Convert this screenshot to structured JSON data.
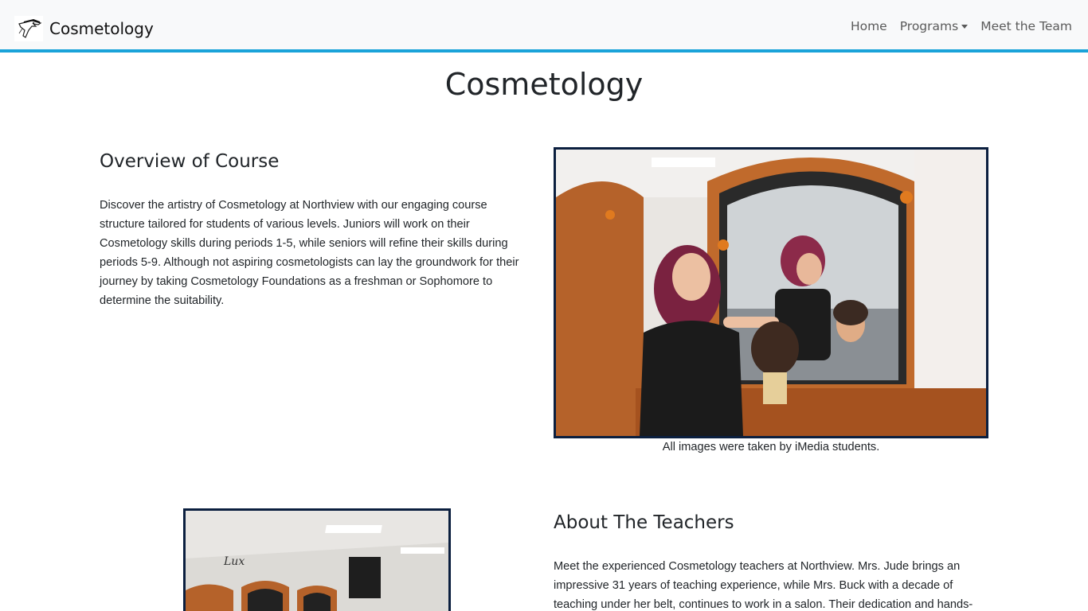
{
  "navbar": {
    "brand_text": "Cosmetology",
    "logo_icon": "husky-mascot-logo",
    "accent_color": "#1aa3d9",
    "items": [
      {
        "label": "Home"
      },
      {
        "label": "Programs",
        "dropdown": true
      },
      {
        "label": "Meet the Team"
      }
    ]
  },
  "page": {
    "title": "Cosmetology"
  },
  "overview": {
    "heading": "Overview of Course",
    "text": "Discover the artistry of Cosmetology at Northview with our engaging course structure tailored for students of various levels. Juniors will work on their Cosmetology skills during periods 1-5, while seniors will refine their skills during periods 5-9. Although not aspiring cosmetologists can lay the groundwork for their journey by taking Cosmetology Foundations as a freshman or Sophomore to determine the suitability."
  },
  "images": {
    "caption": "All images were taken by iMedia students.",
    "frame_color": "#0b1f3f"
  },
  "teachers": {
    "heading": "About The Teachers",
    "text": "Meet the experienced Cosmetology teachers at Northview. Mrs. Jude brings an impressive 31 years of teaching experience, while Mrs. Buck with a decade of teaching under her belt, continues to work in a salon. Their dedication and hands-"
  }
}
